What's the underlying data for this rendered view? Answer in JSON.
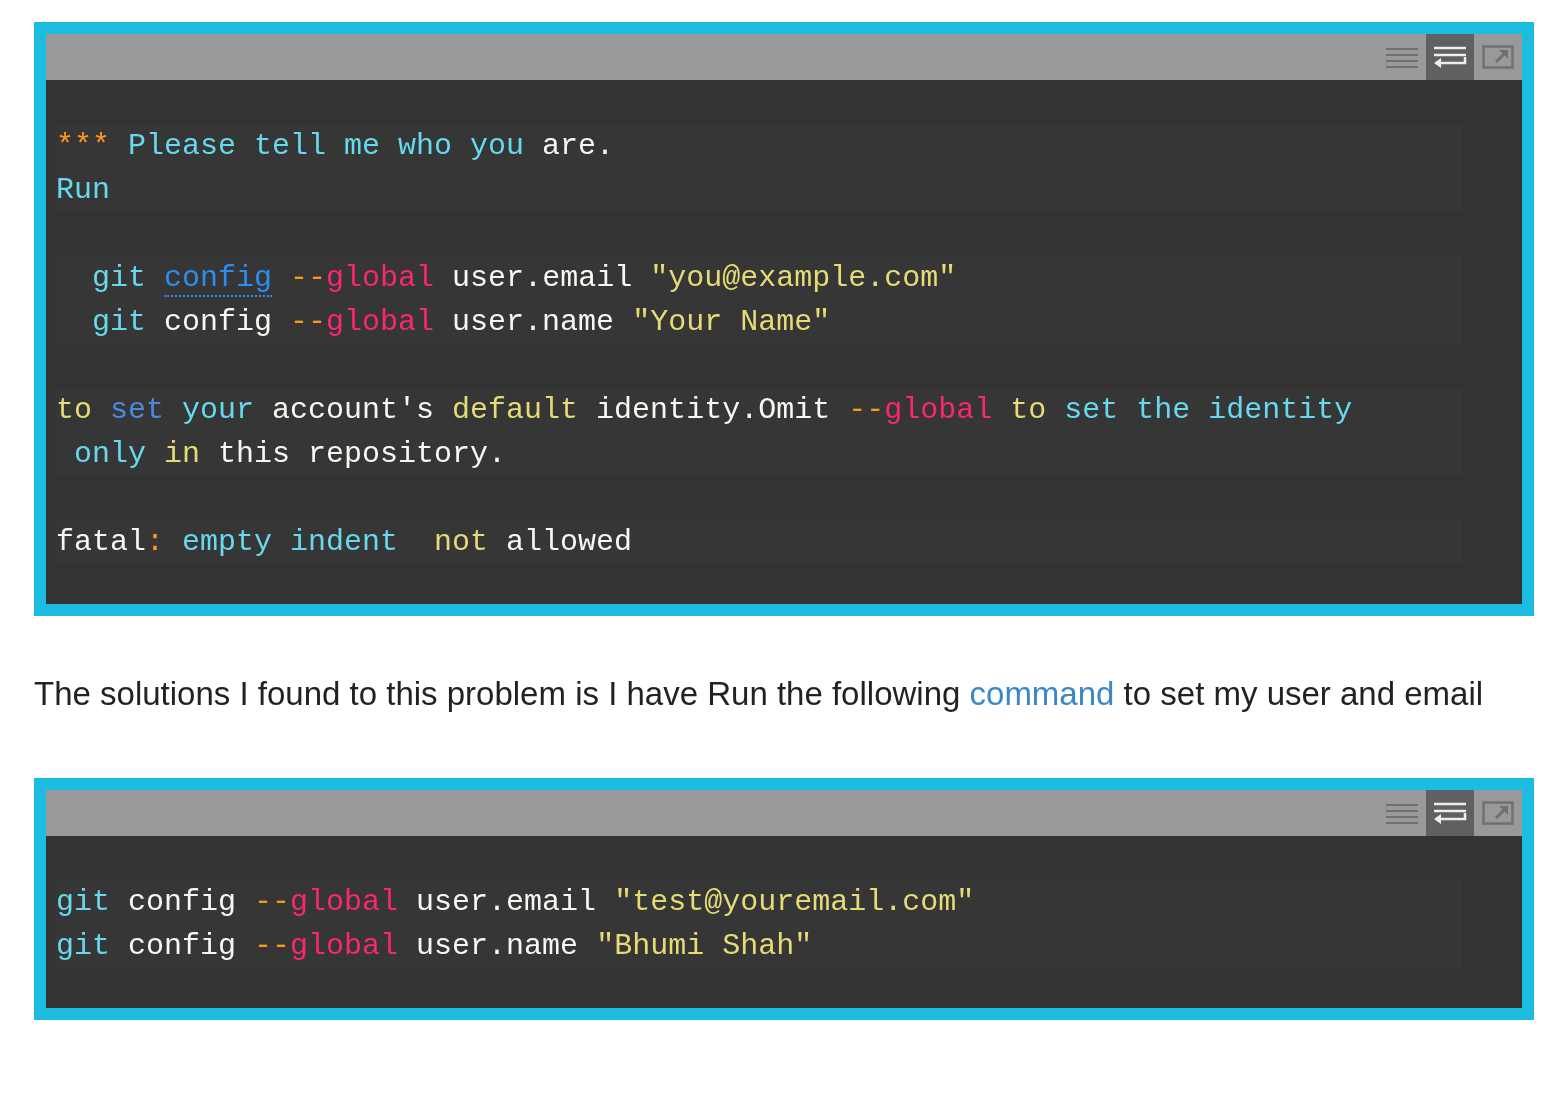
{
  "code_blocks": [
    {
      "toolbar": [
        {
          "kind": "lines",
          "selected": false
        },
        {
          "kind": "wrap",
          "selected": true
        },
        {
          "kind": "popout",
          "selected": false
        }
      ],
      "groups": [
        [
          {
            "tokens": [
              {
                "kind": "mark",
                "text": "***"
              },
              {
                "kind": "keyword",
                "text": " Please tell me who you"
              },
              {
                "kind": "plain",
                "text": " are."
              }
            ]
          },
          {
            "tokens": [
              {
                "kind": "keyword",
                "text": "Run"
              }
            ]
          }
        ],
        [
          {
            "tokens": [
              {
                "kind": "keyword",
                "text": "  git "
              },
              {
                "kind": "link",
                "text": "config"
              },
              {
                "kind": "dash",
                "text": " --"
              },
              {
                "kind": "flag",
                "text": "global"
              },
              {
                "kind": "plain",
                "text": " user.email "
              },
              {
                "kind": "string",
                "text": "\"you@example.com\""
              }
            ]
          },
          {
            "tokens": [
              {
                "kind": "keyword",
                "text": "  git"
              },
              {
                "kind": "plain",
                "text": " config"
              },
              {
                "kind": "dash",
                "text": " --"
              },
              {
                "kind": "flag",
                "text": "global"
              },
              {
                "kind": "plain",
                "text": " user.name "
              },
              {
                "kind": "string",
                "text": "\"Your Name\""
              }
            ]
          }
        ],
        [
          {
            "tokens": [
              {
                "kind": "string",
                "text": "to"
              },
              {
                "kind": "builtin",
                "text": " set"
              },
              {
                "kind": "keyword",
                "text": " your"
              },
              {
                "kind": "plain",
                "text": " account's"
              },
              {
                "kind": "string",
                "text": " default"
              },
              {
                "kind": "plain",
                "text": " identity.Omit"
              },
              {
                "kind": "dash",
                "text": " --"
              },
              {
                "kind": "flag",
                "text": "global"
              },
              {
                "kind": "string",
                "text": " to"
              },
              {
                "kind": "keyword",
                "text": " set the identity"
              }
            ]
          },
          {
            "tokens": [
              {
                "kind": "keyword",
                "text": " only"
              },
              {
                "kind": "string",
                "text": " in"
              },
              {
                "kind": "plain",
                "text": " this repository."
              }
            ]
          }
        ],
        [
          {
            "tokens": [
              {
                "kind": "plain",
                "text": "fatal"
              },
              {
                "kind": "dash",
                "text": ":"
              },
              {
                "kind": "keyword",
                "text": " empty indent"
              },
              {
                "kind": "string",
                "text": "  not"
              },
              {
                "kind": "plain",
                "text": " allowed"
              }
            ]
          }
        ]
      ]
    },
    {
      "paragraph": {
        "before": "The solutions I found to this problem is I have Run the following ",
        "link": "command",
        "after": " to set my user and email"
      }
    },
    {
      "toolbar": [
        {
          "kind": "lines",
          "selected": false
        },
        {
          "kind": "wrap",
          "selected": true
        },
        {
          "kind": "popout",
          "selected": false
        }
      ],
      "groups": [
        [
          {
            "tokens": [
              {
                "kind": "keyword",
                "text": "git"
              },
              {
                "kind": "plain",
                "text": " config"
              },
              {
                "kind": "dash",
                "text": " --"
              },
              {
                "kind": "flag",
                "text": "global"
              },
              {
                "kind": "plain",
                "text": " user.email "
              },
              {
                "kind": "string",
                "text": "\"test@youremail.com\""
              }
            ]
          },
          {
            "tokens": [
              {
                "kind": "keyword",
                "text": "git"
              },
              {
                "kind": "plain",
                "text": " config"
              },
              {
                "kind": "dash",
                "text": " --"
              },
              {
                "kind": "flag",
                "text": "global"
              },
              {
                "kind": "plain",
                "text": " user.name "
              },
              {
                "kind": "string",
                "text": "\"Bhumi Shah\""
              }
            ]
          }
        ]
      ]
    }
  ]
}
